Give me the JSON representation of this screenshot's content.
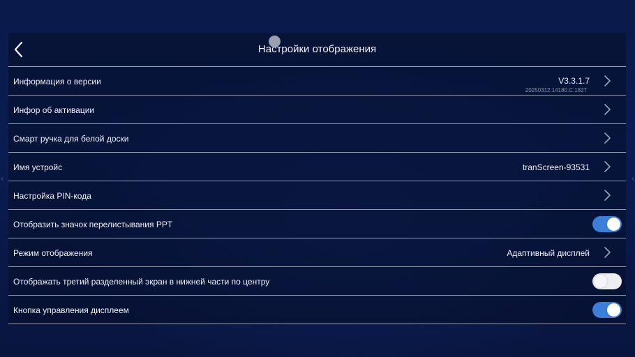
{
  "header": {
    "title": "Настройки отображения",
    "back_icon": "chevron-left-icon"
  },
  "rows": [
    {
      "id": "version",
      "label": "Информация о версии",
      "value": "V3.3.1.7",
      "sub": "20250312.14180.C.1827",
      "control": "chevron"
    },
    {
      "id": "activation",
      "label": "Инфор об активации",
      "control": "chevron"
    },
    {
      "id": "smart-pen",
      "label": "Смарт ручка для белой доски",
      "control": "chevron"
    },
    {
      "id": "device-name",
      "label": "Имя устройс",
      "value": "tranScreen-93531",
      "control": "chevron"
    },
    {
      "id": "pin",
      "label": "Настройка PIN-кода",
      "control": "chevron"
    },
    {
      "id": "ppt-icon",
      "label": "Отобразить значок перелистывания PPT",
      "control": "toggle",
      "on": true
    },
    {
      "id": "display-mode",
      "label": "Режим отображения",
      "value": "Адаптивный дисплей",
      "control": "chevron"
    },
    {
      "id": "split-screen",
      "label": "Отображать третий разделенный экран в нижней части по центру",
      "control": "toggle",
      "on": false
    },
    {
      "id": "display-control",
      "label": "Кнопка управления дисплеем",
      "control": "toggle",
      "on": true
    }
  ],
  "colors": {
    "toggle_on": "#3b7fd8",
    "toggle_off": "#eceef2",
    "background": "#0a1a4a"
  }
}
